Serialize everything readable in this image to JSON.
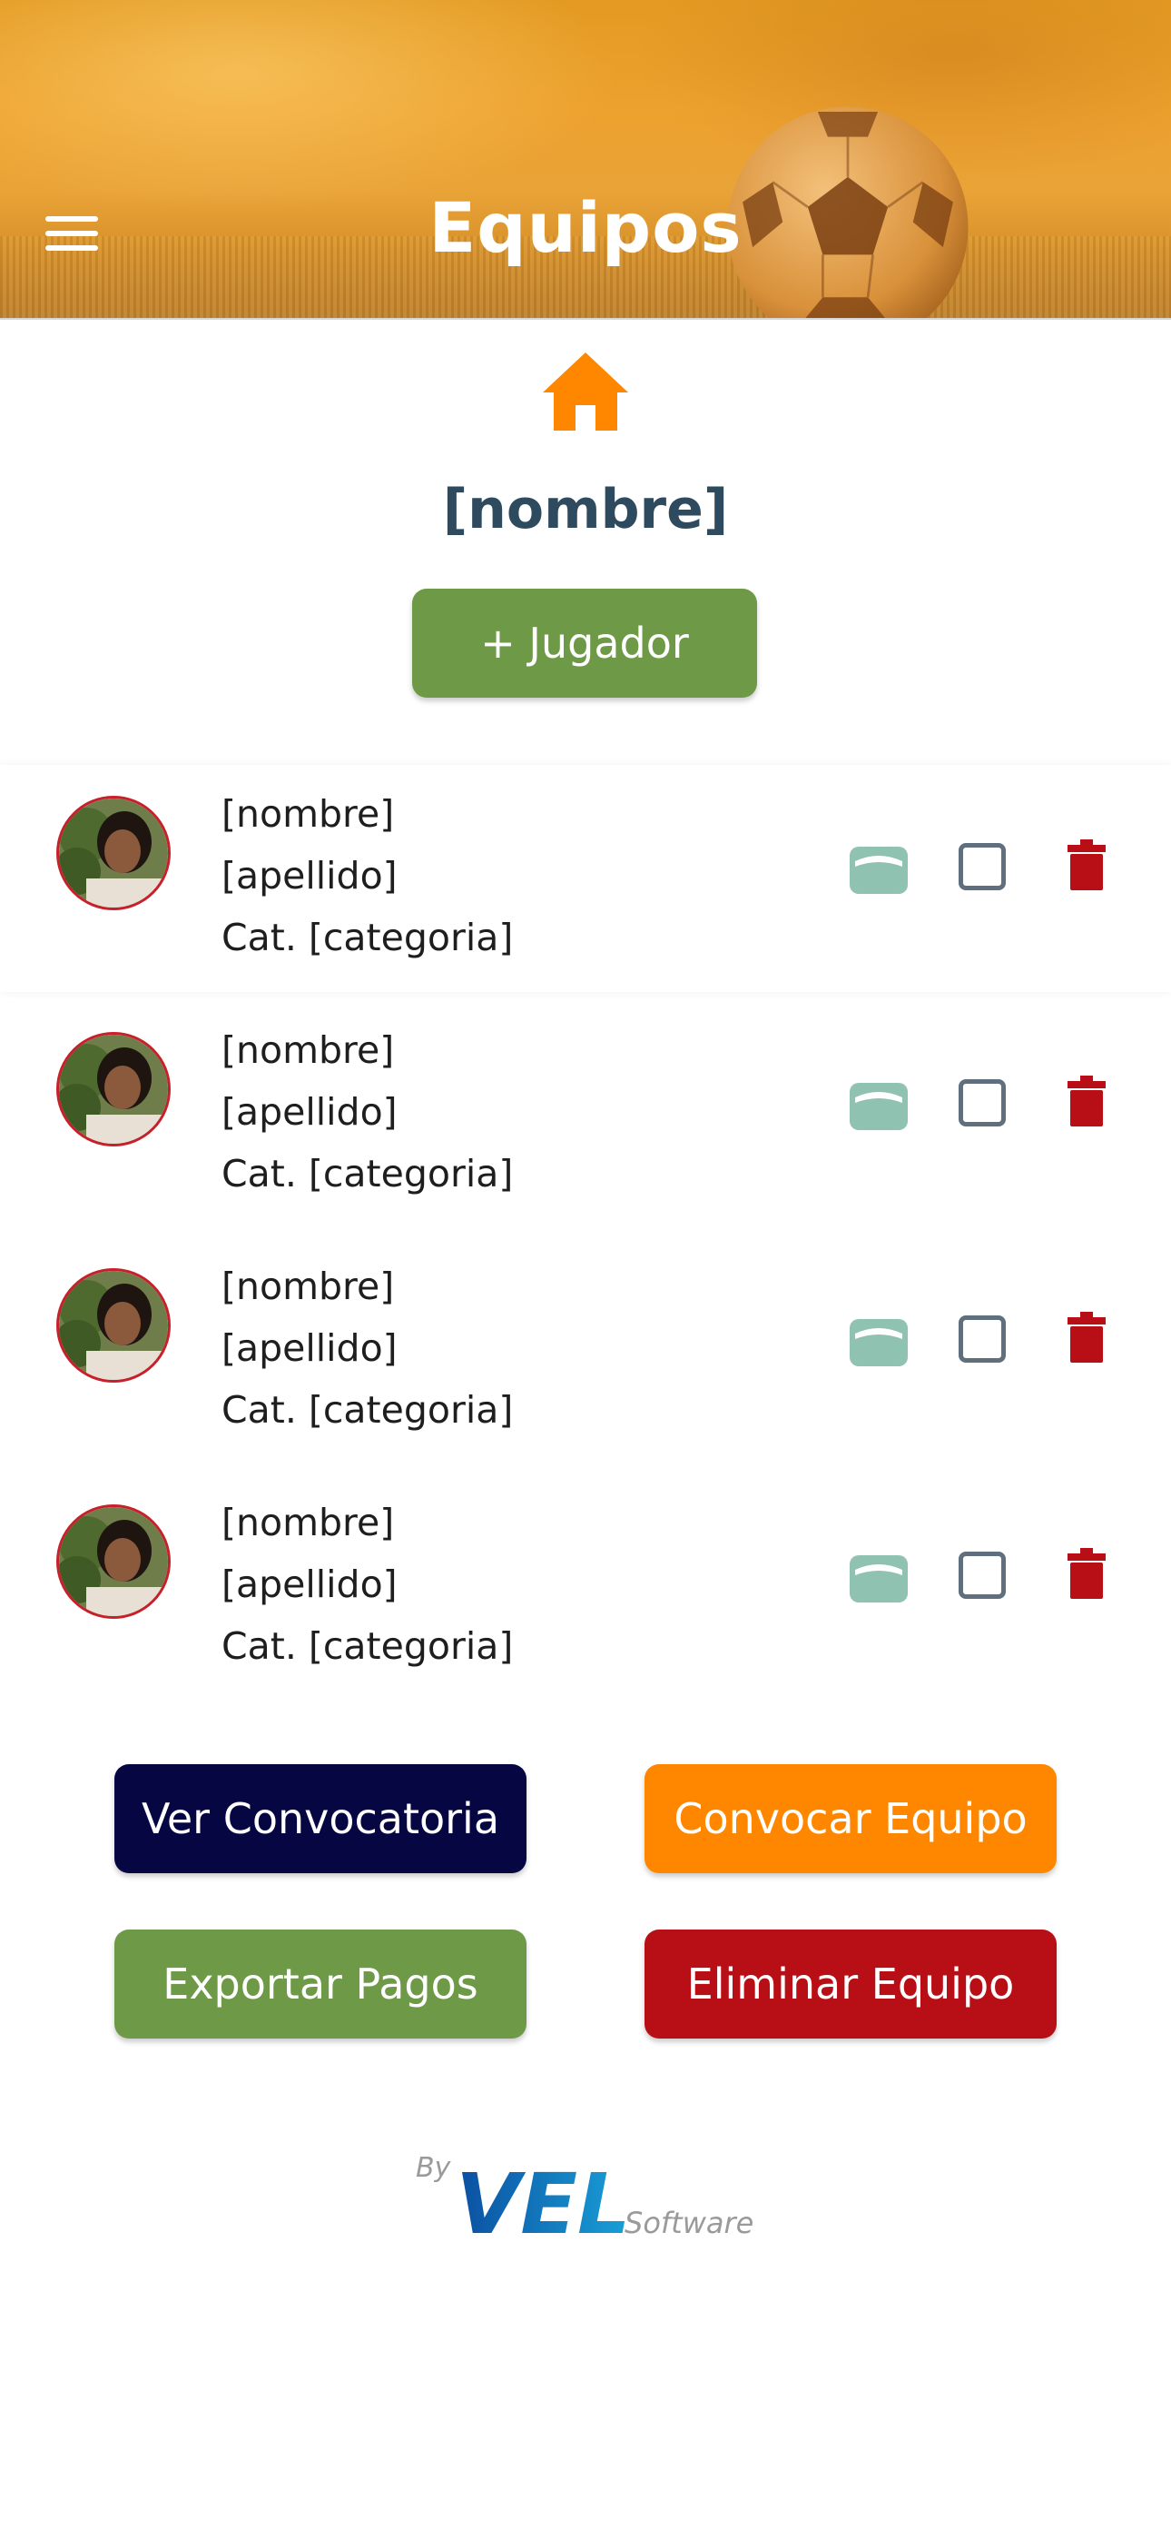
{
  "header": {
    "title": "Equipos",
    "menu_icon": "hamburger-menu-icon",
    "background": "soccer-ball-on-field"
  },
  "home_icon": "home-icon",
  "team": {
    "name": "[nombre]",
    "add_player_label": "+ Jugador"
  },
  "players": [
    {
      "nombre": "[nombre]",
      "apellido": "[apellido]",
      "categoria": "Cat. [categoria]",
      "checked": false
    },
    {
      "nombre": "[nombre]",
      "apellido": "[apellido]",
      "categoria": "Cat. [categoria]",
      "checked": false
    },
    {
      "nombre": "[nombre]",
      "apellido": "[apellido]",
      "categoria": "Cat. [categoria]",
      "checked": false
    },
    {
      "nombre": "[nombre]",
      "apellido": "[apellido]",
      "categoria": "Cat. [categoria]",
      "checked": false
    }
  ],
  "actions": {
    "ver_convocatoria": "Ver Convocatoria",
    "convocar_equipo": "Convocar Equipo",
    "exportar_pagos": "Exportar Pagos",
    "eliminar_equipo": "Eliminar Equipo"
  },
  "footer": {
    "by": "By",
    "brand": "VEL",
    "suffix": "Software"
  },
  "colors": {
    "accent_orange": "#ff8700",
    "green": "#6e9a48",
    "navy": "#060742",
    "red": "#b80f17",
    "teal_card": "#8fc2b0",
    "title_dark": "#2e4a5e"
  }
}
